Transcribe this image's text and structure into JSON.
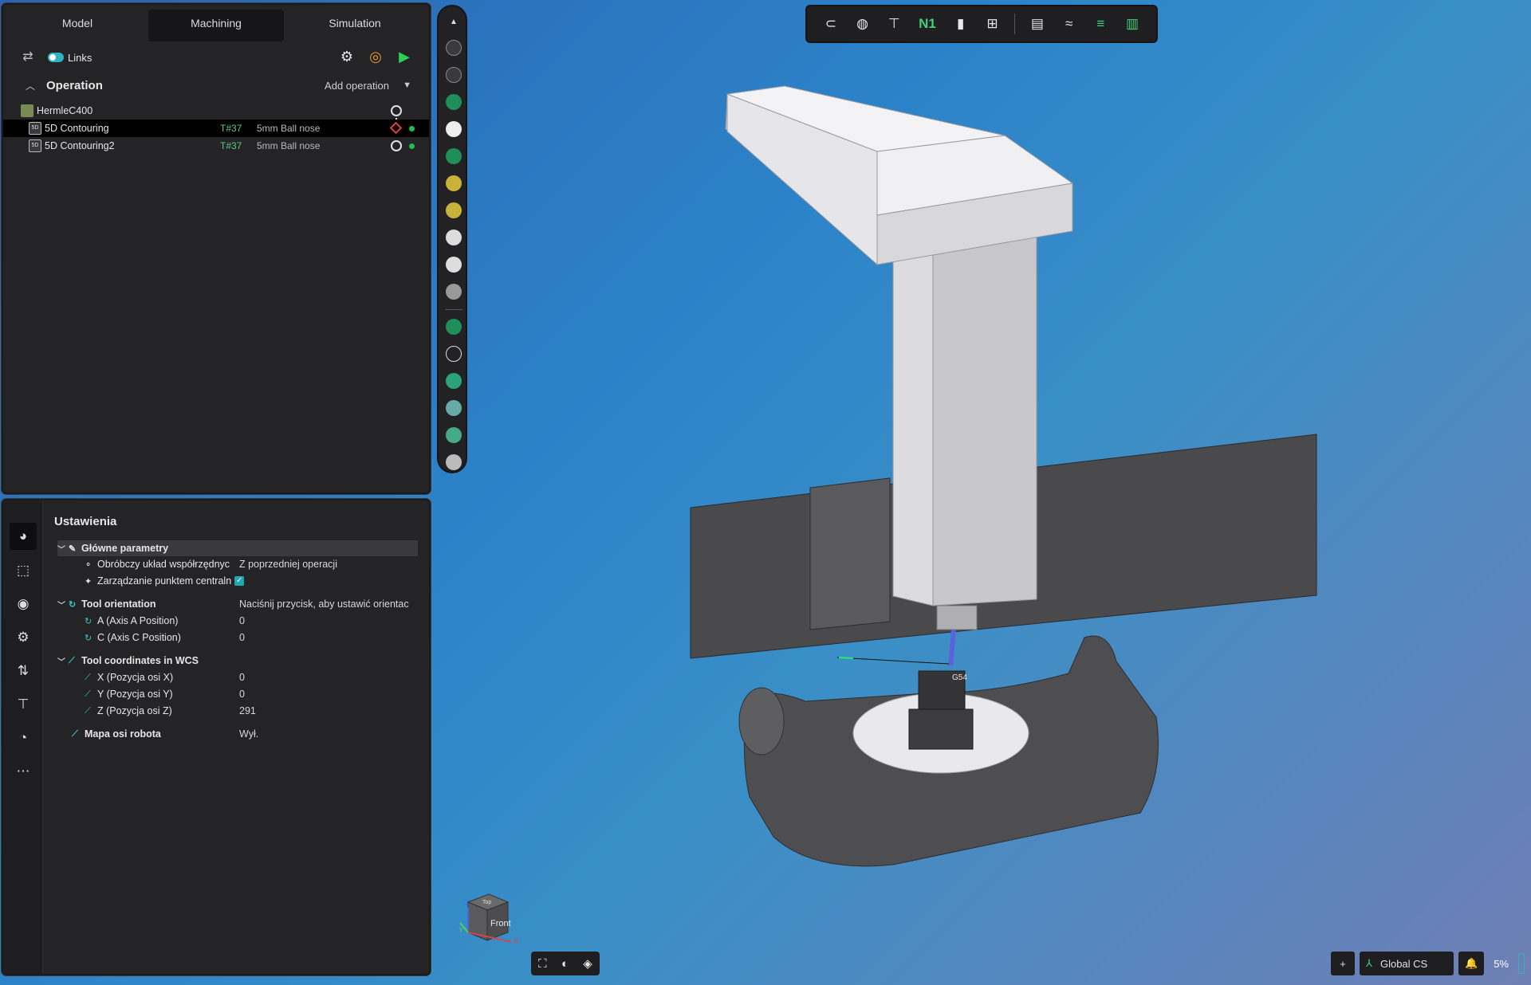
{
  "tabs": [
    {
      "label": "Model"
    },
    {
      "label": "Machining"
    },
    {
      "label": "Simulation"
    }
  ],
  "toolbar": {
    "links_label": "Links"
  },
  "operation": {
    "title": "Operation",
    "add_label": "Add operation"
  },
  "tree": {
    "machine": "HermleC400",
    "ops": [
      {
        "name": "5D Contouring",
        "tool_num": "T#37",
        "tool_name": "5mm Ball nose"
      },
      {
        "name": "5D Contouring2",
        "tool_num": "T#37",
        "tool_name": "5mm Ball nose"
      }
    ]
  },
  "settings": {
    "title": "Ustawienia",
    "main_group": "Główne parametry",
    "wcs_label": "Obróbczy układ współrzędnyc",
    "wcs_value": "Z poprzedniej operacji",
    "center_label": "Zarządzanie punktem centraln",
    "orientation_group": "Tool orientation",
    "orientation_value": "Naciśnij przycisk, aby ustawić orientac",
    "axis_a_label": "A (Axis A Position)",
    "axis_a_value": "0",
    "axis_c_label": "C (Axis C Position)",
    "axis_c_value": "0",
    "coords_group": "Tool coordinates in WCS",
    "x_label": "X (Pozycja osi X)",
    "x_value": "0",
    "y_label": "Y (Pozycja osi Y)",
    "y_value": "0",
    "z_label": "Z (Pozycja osi Z)",
    "z_value": "291",
    "robot_label": "Mapa osi robota",
    "robot_value": "Wył."
  },
  "top_tools": {
    "n1_label": "N1"
  },
  "viewport": {
    "cs_label": "G54",
    "cube_front": "Front",
    "cube_top": "Top",
    "axis_x": "X",
    "axis_y": "Y",
    "axis_z": "Z"
  },
  "status": {
    "cs_label": "Global CS",
    "zoom": "5%"
  },
  "colors": {
    "accent": "#2fb3c0",
    "tool_green": "#59c886",
    "panel_bg": "#242426"
  }
}
